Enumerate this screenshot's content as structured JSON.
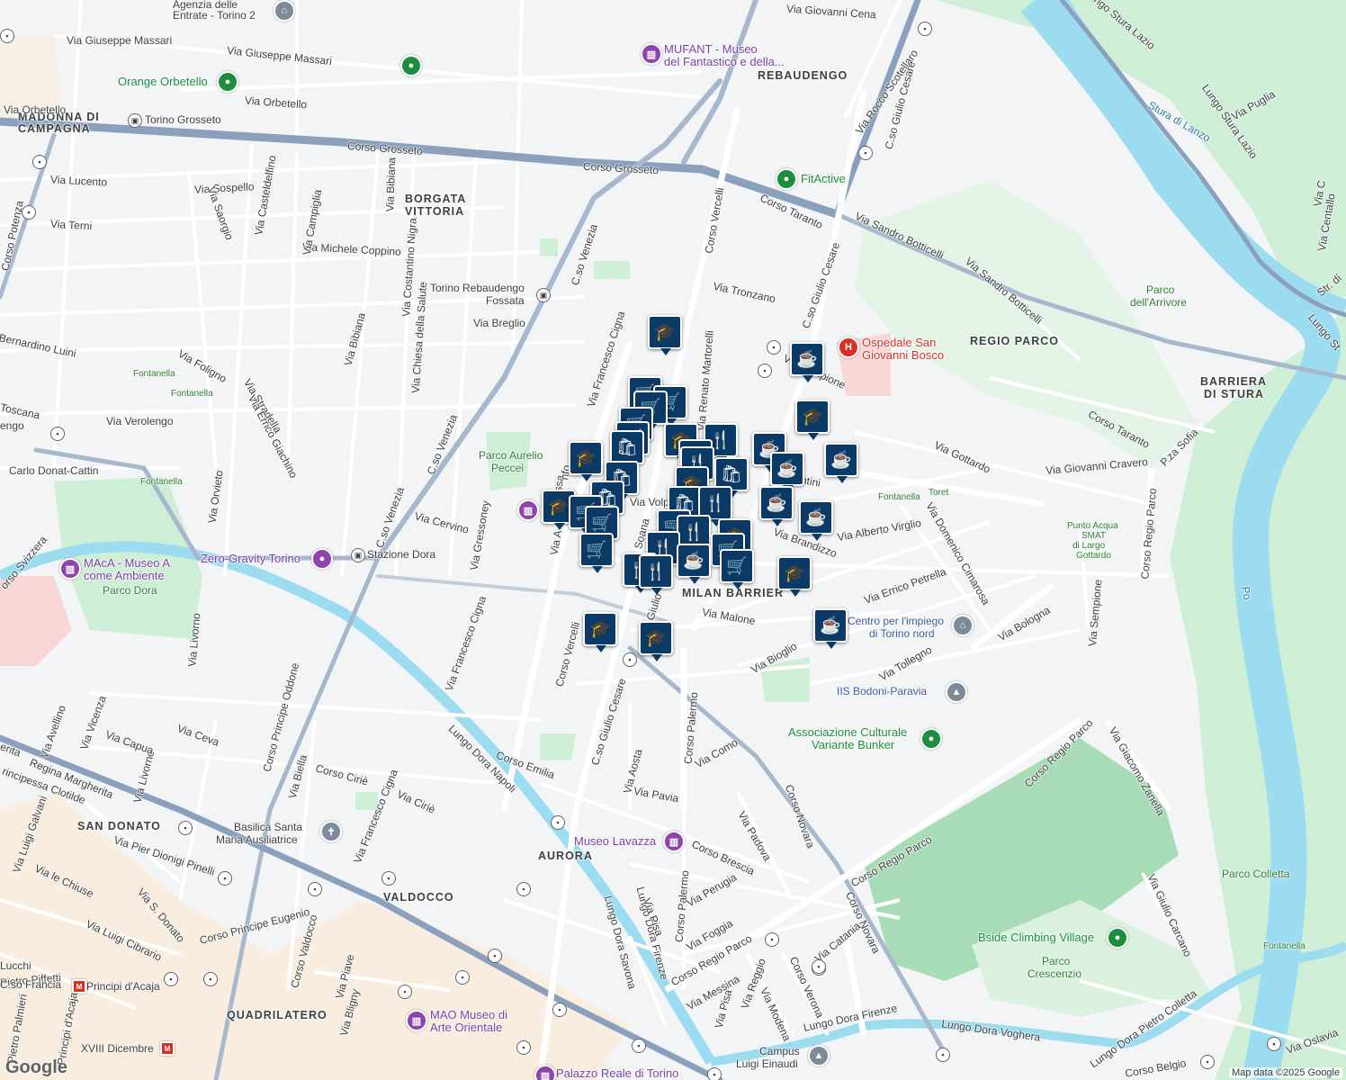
{
  "map": {
    "attribution": "Map data ©2025 Google",
    "logo": "Google",
    "colors": {
      "water": "#9cdcf0",
      "park": "#c8ebcf",
      "major_road": "#8aa0bd",
      "road": "#ffffff",
      "pin": "#0b3a66",
      "poi_green": "#1e8e3e",
      "poi_purple": "#8e44ad",
      "hospital": "#d93025"
    }
  },
  "districts": {
    "madonna": "MADONNA DI",
    "campagna": "CAMPAGNA",
    "borgata": "BORGATA",
    "vittoria": "VITTORIA",
    "rebaudengo": "REBAUDENGO",
    "regio_parco": "REGIO PARCO",
    "barriera": "BARRIERA",
    "di_stura": "DI STURA",
    "milan_barrier": "MILAN BARRIER",
    "san_donato": "SAN DONATO",
    "aurora": "AURORA",
    "valdocco": "VALDOCCO",
    "quadrilatero": "QUADRILATERO"
  },
  "pois": {
    "agenzia1": "Agenzia delle",
    "agenzia2": "Entrate - Torino 2",
    "mufant1": "MUFANT - Museo",
    "mufant2": "del Fantastico e della...",
    "orange": "Orange Orbetello",
    "fitactive": "FitActive",
    "ospedale1": "Ospedale San",
    "ospedale2": "Giovanni Bosco",
    "parco_aurelio1": "Parco Aurelio",
    "parco_aurelio2": "Peccei",
    "maca1": "MAcA - Museo A",
    "maca2": "come Ambiente",
    "parco_dora": "Parco Dora",
    "zero_gravity": "Zero-Gravity Torino",
    "stazione_dora": "Stazione Dora",
    "torino_grosseto": "Torino Grosseto",
    "rebaudengo_fossata1": "Torino Rebaudengo",
    "rebaudengo_fossata2": "Fossata",
    "centro_impiego1": "Centro per l'impiego",
    "centro_impiego2": "di Torino nord",
    "iis_bodoni": "IIS Bodoni-Paravia",
    "variante1": "Associazione Culturale",
    "variante2": "Variante Bunker",
    "lavazza": "Museo Lavazza",
    "basilica1": "Basilica Santa",
    "basilica2": "Maria Ausiliatrice",
    "mao1": "MAO Museo di",
    "mao2": "Arte Orientale",
    "palazzo": "Palazzo Reale di Torino",
    "campus1": "Campus",
    "campus2": "Luigi Einaudi",
    "bside": "Bside Climbing Village",
    "parco_colletta": "Parco Colletta",
    "parco_crescenzio1": "Parco",
    "parco_crescenzio2": "Crescenzio",
    "parco_arrivore1": "Parco",
    "parco_arrivore2": "dell'Arrivore",
    "fontanella": "Fontanella",
    "toret": "Toret",
    "punto_acqua1": "Punto Acqua",
    "punto_acqua2": "SMAT",
    "punto_acqua3": "di Largo",
    "punto_acqua4": "Gottardo",
    "principi": "Principi d'Acaja",
    "xviii": "XVIII Dicembre",
    "stura": "Stura di Lanzo",
    "po": "Po"
  },
  "streets": {
    "corso_grosseto": "Corso Grosseto",
    "corso_grosseto2": "Corso Grosseto",
    "via_giuseppe_massari": "Via Giuseppe Massari",
    "via_giuseppe_massari2": "Via Giuseppe Massari",
    "via_orbetello": "Via Orbetello",
    "via_orbetello2": "Via Orbetello",
    "via_giovanni_cena": "Via Giovanni Cena",
    "via_rocco": "Via Rocco Scotellaro",
    "c_so_giulio_cesare": "C.so Giulio Cesare",
    "c_so_giulio_cesare2": "C.so Giulio Cesare",
    "c_so_giulio_cesare3": "C.so Giulio Cesare",
    "corso_vercelli": "Corso Vercelli",
    "corso_vercelli2": "Corso Vercelli",
    "corso_taranto": "Corso Taranto",
    "corso_taranto2": "Corso Taranto",
    "via_sandro_botticelli": "Via Sandro Botticelli",
    "via_sandro_botticelli2": "Via Sandro Botticelli",
    "via_tronzano": "Via Tronzano",
    "via_breglio": "Via Breglio",
    "via_francesco_cigna": "Via Francesco Cigna",
    "via_francesco_cigna2": "Via Francesco Cigna",
    "via_francesco_cigna3": "Via Francesco Cigna",
    "c_so_venezia": "C.so Venezia",
    "c_so_venezia2": "C.so Venezia",
    "c_so_venezia3": "C.so Venezia",
    "via_lucento": "Via Lucento",
    "via_sospello": "Via Sospello",
    "via_terni": "Via Terni",
    "via_michele_coppino": "Via Michele Coppino",
    "via_casteldelfino": "Via Casteldelfino",
    "via_bibiana": "Via Bibiana",
    "via_bibiana2": "Via Bibiana",
    "via_campiglia": "Via Campiglia",
    "via_saorgio": "Via Saorgio",
    "via_costantino_nigra": "Via Costantino Nigra",
    "via_chiesa": "Via Chiesa della Salute",
    "corso_potenza": "Corso Potenza",
    "via_bernardino_luini": "Bernardino Luini",
    "via_foligno": "Via Foligno",
    "via_stradella": "Via Stradella",
    "via_errico_giachino": "Via Errico Giachino",
    "via_verolengo": "Via Verolengo",
    "via_toscana": "Toscana",
    "via_engo": "engo",
    "carlo_donat": "Carlo Donat-Cattin",
    "via_orvieto": "Via Orvieto",
    "via_cervino": "Via Cervino",
    "via_gressoney": "Via Gressoney",
    "corso_svizzera": "orso Svizzera",
    "via_livorno": "Via Livorno",
    "via_livorno2": "Via Livorno",
    "via_renato_martorelli": "Via Renato Martorelli",
    "via_sempione": "Via Sempione",
    "via_sempione2": "Via Sempione",
    "via_gottardo": "Via Gottardo",
    "via_giovanni_cravero": "Via Giovanni Cravero",
    "p_za_sofia": "P.za Sofia",
    "corso_regio_parco": "Corso Regio Parco",
    "corso_regio_parco2": "Corso Regio Parco",
    "corso_regio_parco3": "Corso Regio Parco",
    "corso_regio_parco4": "Corso Regio Parco",
    "via_alberto_virglio": "Via Alberto Virglio",
    "via_brandizzo": "Via Brandizzo",
    "via_domenico_cimarosa": "Via Domenico Cimarosa",
    "via_errico_petrella": "Via Errico Petrella",
    "via_malone": "Via Malone",
    "via_bioglio": "Via Bioglio",
    "via_tollegno": "Via Tollegno",
    "via_bologna": "Via Bologna",
    "via_giacomo_zanella": "Via Giacomo Zanella",
    "via_volpi": "Via Volpi",
    "via_soana": "Soana",
    "via_giulio": "o Giulio",
    "via_antini": "ntini",
    "via_a": "Via A",
    "via_assa": "ssa",
    "via_nfo": "nfo",
    "via_ceva": "Via Ceva",
    "via_capua": "Via Capua",
    "via_avellino": "Via Avellino",
    "via_vicenza": "Via Vicenza",
    "corso_principe_oddone": "Corso Principe Oddone",
    "via_biella": "Via Biella",
    "corso_cirie": "Corso Ciriè",
    "via_cirie": "Via Ciriè",
    "lungo_dora_napoli": "Lungo Dora Napoli",
    "corso_emilia": "Corso Emilia",
    "via_aosta": "Via Aosta",
    "via_pavia": "Via Pavia",
    "corso_palermo": "Corso Palermo",
    "corso_palermo2": "Corso Palermo",
    "via_como": "Via Como",
    "corso_novara": "Corso Novara",
    "corso_novara2": "Corso Novara",
    "via_padova": "Via Padova",
    "corso_brescia": "Corso Brescia",
    "regina_margherita": "Regina Margherita",
    "erita": "erita",
    "principessa_clotilde": "rincipessa Clotilde",
    "via_luigi_galvani": "Via Luigi Galvani",
    "via_pier_dionigi_pinelli": "Via Pier Dionigi Pinelli",
    "via_le_chiuse": "Via le Chiuse",
    "via_s_donato": "Via S. Donato",
    "via_luigi_cibrario": "Via Luigi Cibrario",
    "corso_principe_eugenio": "Corso Principe Eugenio",
    "corso_valdocco": "Corso Valdocco",
    "via_piave": "Via Piave",
    "via_bligny": "Via Bligny",
    "lucchi": "Lucchi",
    "pietro_piffetti": "Pietro Piffetti",
    "c_so_francia": "C.so Francia",
    "pietro_palmieri": "Pietro Palmieri",
    "principi_acaja_road": "Principi d'Acaja",
    "lungo_dora_firenze": "Lungo Dora Firenze",
    "lungo_dora_firenze2": "Lungo Dora Firenze",
    "lungo_dora_savona": "Lungo Dora Savona",
    "via_pisa": "Via Pisa",
    "via_pisa2": "Via Pisa",
    "via_perugia": "Via Perugia",
    "via_foggia": "Via Foggia",
    "via_messina": "Via Messina",
    "via_reggio": "Via Reggio",
    "via_modena": "Via Modena",
    "corso_verona": "Corso Verona",
    "via_catania": "Via Catania",
    "lungo_dora_voghera": "Lungo Dora Voghera",
    "lungo_dora_pietro_colletta": "Lungo Dora Pietro Colletta",
    "corso_belgio": "Corso Belgio",
    "via_oslavia": "Via Oslavia",
    "via_giulio_carcano": "Via Giulio Carcano",
    "lungo_stura_lazio": "Lungo Stura Lazio",
    "lungo_stura_lazio2": "Lungo Stura Lazio",
    "lungo_stura3": "Lungo St",
    "via_puglia": "Via Puglia",
    "via_centallo": "Via Centallo",
    "str_di": "Str. di",
    "via_cent": "Via C"
  }
}
